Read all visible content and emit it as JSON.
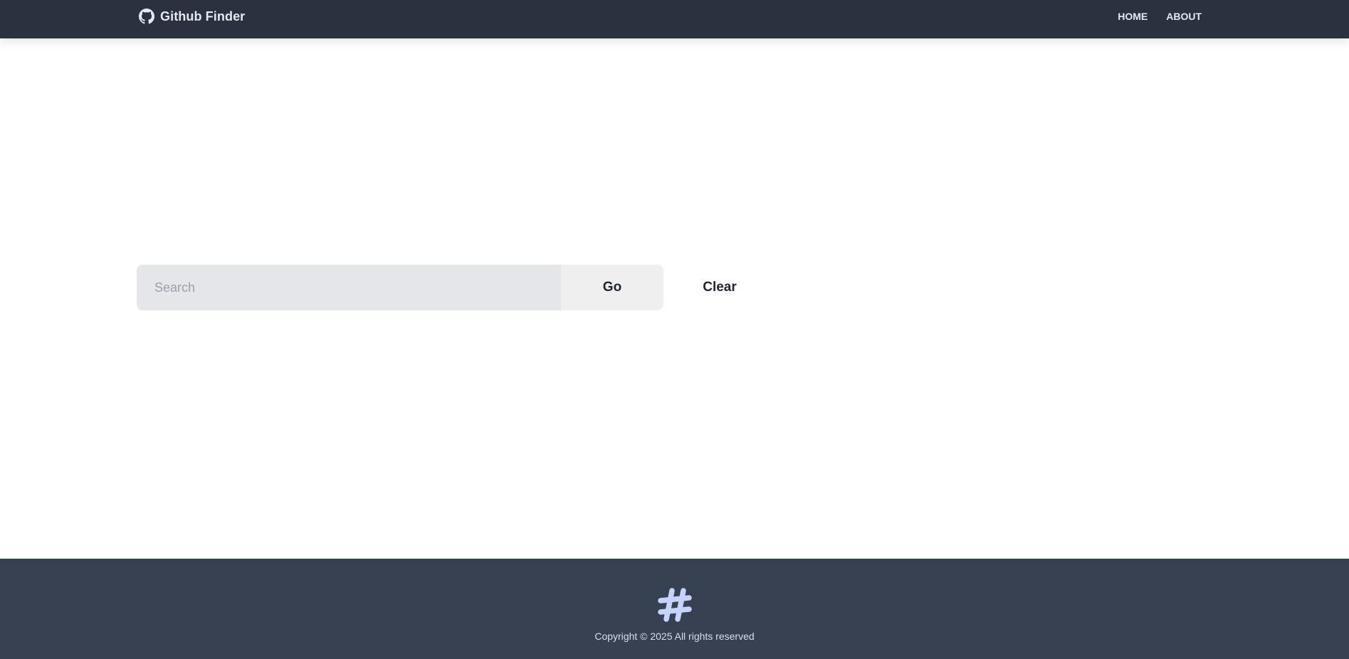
{
  "colors": {
    "navbar_bg": "#2a3240",
    "footer_bg": "#374151",
    "search_bg": "#e5e6e9",
    "go_button_bg": "#efefef",
    "text_dark": "#1f2533",
    "footer_text": "#d9def0",
    "logo_color": "#c7d2fe"
  },
  "navbar": {
    "brand_icon": "github-icon",
    "brand_title": "Github Finder",
    "links": [
      {
        "label": "HOME"
      },
      {
        "label": "ABOUT"
      }
    ]
  },
  "search": {
    "value": "",
    "placeholder": "Search",
    "go_label": "Go",
    "clear_label": "Clear"
  },
  "footer": {
    "logo_icon": "hashtag-icon",
    "copyright": "Copyright © 2025 All rights reserved"
  }
}
